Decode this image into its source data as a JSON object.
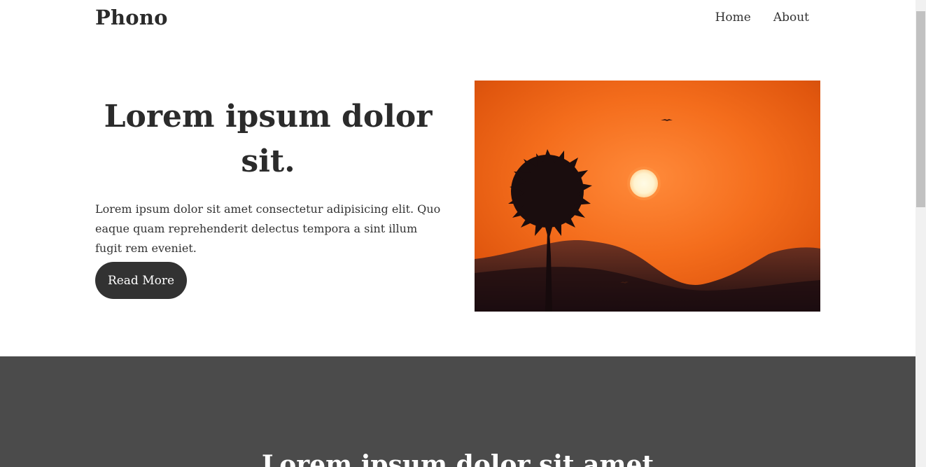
{
  "header": {
    "logo": "Phono",
    "nav": [
      {
        "label": "Home"
      },
      {
        "label": "About"
      }
    ]
  },
  "hero": {
    "title": "Lorem ipsum dolor sit.",
    "description": "Lorem ipsum dolor sit amet consectetur adipisicing elit. Quo eaque quam reprehenderit delectus tempora a sint illum fugit rem eveniet.",
    "button_label": "Read More",
    "image_subject": "sunset-palm-silhouette"
  },
  "section2": {
    "title": "Lorem ipsum dolor sit amet"
  },
  "colors": {
    "text": "#2b2b2b",
    "button_bg": "#323232",
    "dark_section_bg": "#4b4b4b",
    "sky_orange": "#f26a14"
  }
}
